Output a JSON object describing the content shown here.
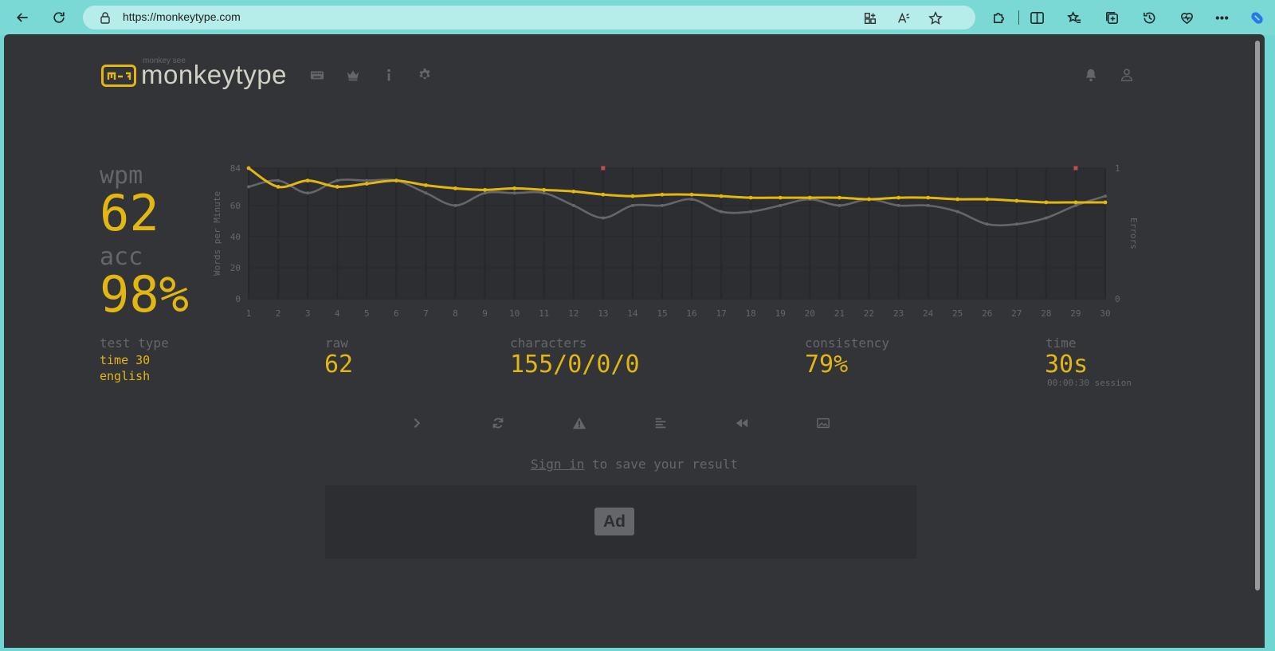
{
  "browser": {
    "url": "https://monkeytype.com"
  },
  "brand": {
    "tagline": "monkey see",
    "name": "monkeytype"
  },
  "stats": {
    "wpm_label": "wpm",
    "wpm_value": "62",
    "acc_label": "acc",
    "acc_value": "98%",
    "test_type_label": "test type",
    "test_type_line1": "time 30",
    "test_type_line2": "english",
    "raw_label": "raw",
    "raw_value": "62",
    "characters_label": "characters",
    "characters_value": "155/0/0/0",
    "consistency_label": "consistency",
    "consistency_value": "79%",
    "time_label": "time",
    "time_value": "30s",
    "session_value": "00:00:30 session"
  },
  "signin": {
    "link": "Sign in",
    "rest": " to save your result"
  },
  "ad": {
    "label": "Ad"
  },
  "colors": {
    "accent": "#e2b714",
    "raw_line": "#646669",
    "error": "#ca4754",
    "bg": "#323437"
  },
  "chart_data": {
    "type": "line",
    "x": [
      1,
      2,
      3,
      4,
      5,
      6,
      7,
      8,
      9,
      10,
      11,
      12,
      13,
      14,
      15,
      16,
      17,
      18,
      19,
      20,
      21,
      22,
      23,
      24,
      25,
      26,
      27,
      28,
      29,
      30
    ],
    "ylabel": "Words per Minute",
    "y2label": "Errors",
    "ylim": [
      0,
      84
    ],
    "yticks": [
      0,
      20,
      40,
      60,
      84
    ],
    "y2lim": [
      0,
      1
    ],
    "y2ticks": [
      0,
      1
    ],
    "series": [
      {
        "values": [
          84,
          72,
          76,
          72,
          74,
          76,
          73,
          71,
          70,
          71,
          70,
          69,
          67,
          66,
          67,
          67,
          66,
          65,
          65,
          65,
          65,
          64,
          65,
          65,
          64,
          64,
          63,
          62,
          62,
          62
        ]
      },
      {
        "values": [
          72,
          76,
          68,
          76,
          76,
          76,
          68,
          60,
          68,
          68,
          68,
          60,
          52,
          60,
          60,
          64,
          56,
          56,
          60,
          64,
          60,
          64,
          60,
          60,
          56,
          48,
          48,
          52,
          60,
          66
        ]
      }
    ],
    "errors": [
      {
        "x": 13,
        "y": 1
      },
      {
        "x": 29,
        "y": 1
      }
    ]
  }
}
